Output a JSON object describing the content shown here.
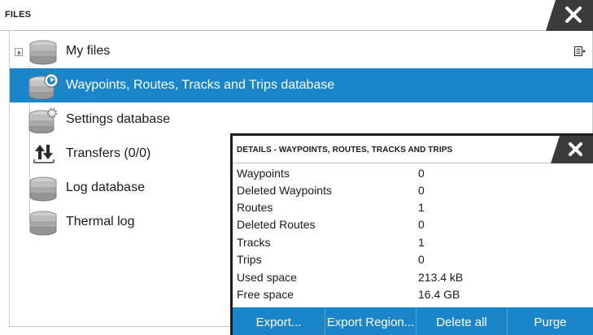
{
  "files": {
    "title": "FILES",
    "items": [
      {
        "label": "My files",
        "icon": "database-icon",
        "expandable": true
      },
      {
        "label": "Waypoints, Routes, Tracks and Trips database",
        "icon": "waypoint-database-icon",
        "selected": true
      },
      {
        "label": "Settings database",
        "icon": "settings-database-icon"
      },
      {
        "label": "Transfers (0/0)",
        "icon": "transfer-icon"
      },
      {
        "label": "Log database",
        "icon": "database-icon"
      },
      {
        "label": "Thermal log",
        "icon": "database-icon"
      }
    ]
  },
  "details": {
    "title": "DETAILS - WAYPOINTS, ROUTES, TRACKS AND TRIPS",
    "properties": [
      {
        "name": "Waypoints",
        "value": "0"
      },
      {
        "name": "Deleted Waypoints",
        "value": "0"
      },
      {
        "name": "Routes",
        "value": "1"
      },
      {
        "name": "Deleted Routes",
        "value": "0"
      },
      {
        "name": "Tracks",
        "value": "1"
      },
      {
        "name": "Trips",
        "value": "0"
      },
      {
        "name": "Used space",
        "value": "213.4 kB"
      },
      {
        "name": "Free space",
        "value": "16.4 GB"
      }
    ],
    "buttons": {
      "export": "Export...",
      "export_region": "Export Region...",
      "delete_all": "Delete all",
      "purge": "Purge"
    }
  },
  "colors": {
    "accent": "#1a85c8",
    "close_tab": "#3b3b3b"
  }
}
